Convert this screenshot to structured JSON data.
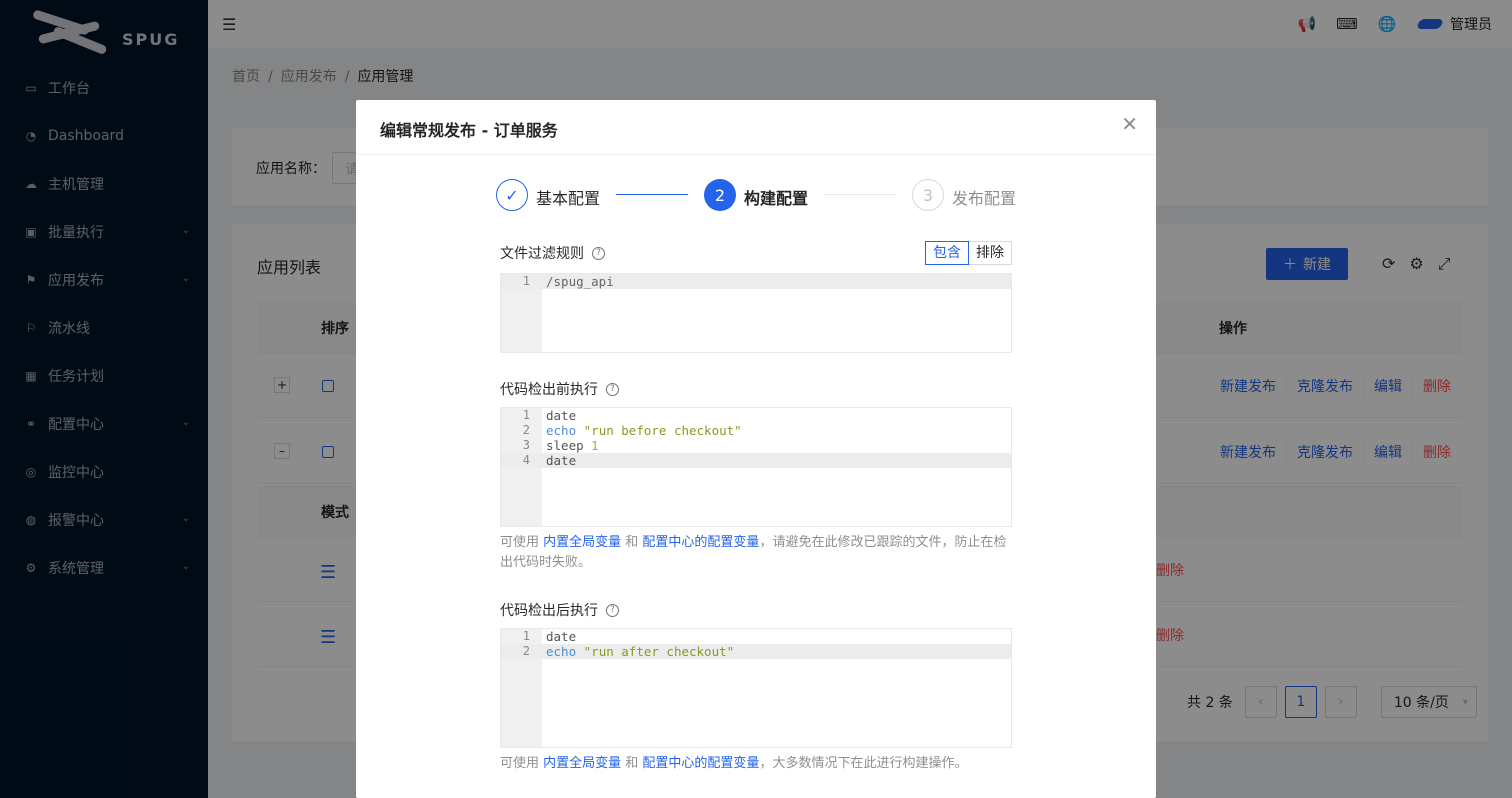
{
  "app": {
    "brand": "SPUG"
  },
  "sidebar": {
    "items": [
      {
        "label": "工作台",
        "icon": "desktop-icon",
        "glyph": "▭",
        "has_arrow": false
      },
      {
        "label": "Dashboard",
        "icon": "dashboard-icon",
        "glyph": "◔",
        "has_arrow": false
      },
      {
        "label": "主机管理",
        "icon": "cloud-server-icon",
        "glyph": "☁",
        "has_arrow": false
      },
      {
        "label": "批量执行",
        "icon": "code-icon",
        "glyph": "▣",
        "has_arrow": true
      },
      {
        "label": "应用发布",
        "icon": "flag-icon",
        "glyph": "⚑",
        "has_arrow": true
      },
      {
        "label": "流水线",
        "icon": "pipeline-icon",
        "glyph": "⚐",
        "has_arrow": false
      },
      {
        "label": "任务计划",
        "icon": "schedule-icon",
        "glyph": "▦",
        "has_arrow": false
      },
      {
        "label": "配置中心",
        "icon": "deployment-icon",
        "glyph": "⚭",
        "has_arrow": true
      },
      {
        "label": "监控中心",
        "icon": "monitor-icon",
        "glyph": "◎",
        "has_arrow": false
      },
      {
        "label": "报警中心",
        "icon": "alert-icon",
        "glyph": "◍",
        "has_arrow": true
      },
      {
        "label": "系统管理",
        "icon": "setting-icon",
        "glyph": "⚙",
        "has_arrow": true
      }
    ]
  },
  "header": {
    "user": "管理员"
  },
  "breadcrumb": {
    "home": "首页",
    "parent": "应用发布",
    "current": "应用管理"
  },
  "search": {
    "label": "应用名称：",
    "placeholder": "请"
  },
  "list": {
    "title": "应用列表",
    "new_button": "新建",
    "col_sort": "排序",
    "col_actions": "操作",
    "rows": [
      {
        "expander": "+",
        "actions": [
          "新建发布",
          "克隆发布",
          "编辑",
          "删除"
        ]
      },
      {
        "expander": "–",
        "actions": [
          "新建发布",
          "克隆发布",
          "编辑",
          "删除"
        ]
      }
    ],
    "sub_col_mode": "模式",
    "sub_delete": "删除",
    "total": "共 2 条",
    "page": "1",
    "page_size": "10 条/页"
  },
  "modal": {
    "title": "编辑常规发布 - 订单服务",
    "steps": [
      {
        "label": "基本配置",
        "status": "finish"
      },
      {
        "label": "构建配置",
        "status": "process",
        "number": "2"
      },
      {
        "label": "发布配置",
        "status": "wait",
        "number": "3"
      }
    ],
    "filter": {
      "label": "文件过滤规则",
      "include": "包含",
      "exclude": "排除",
      "lines": [
        "/spug_api"
      ]
    },
    "pre_checkout": {
      "label": "代码检出前执行",
      "lines": [
        "date",
        "echo \"run before checkout\"",
        "sleep 1",
        "date"
      ]
    },
    "pre_hint": {
      "prefix": "可使用 ",
      "link1": "内置全局变量",
      "mid": " 和 ",
      "link2": "配置中心的配置变量",
      "suffix": "，请避免在此修改已跟踪的文件，防止在检出代码时失败。"
    },
    "post_checkout": {
      "label": "代码检出后执行",
      "lines": [
        "date",
        "echo \"run after checkout\""
      ]
    },
    "post_hint": {
      "prefix": "可使用 ",
      "link1": "内置全局变量",
      "mid": " 和 ",
      "link2": "配置中心的配置变量",
      "suffix": "，大多数情况下在此进行构建操作。"
    }
  },
  "colors": {
    "primary": "#2563eb",
    "danger": "#ff4d4f",
    "sidebar_bg": "#001529"
  }
}
